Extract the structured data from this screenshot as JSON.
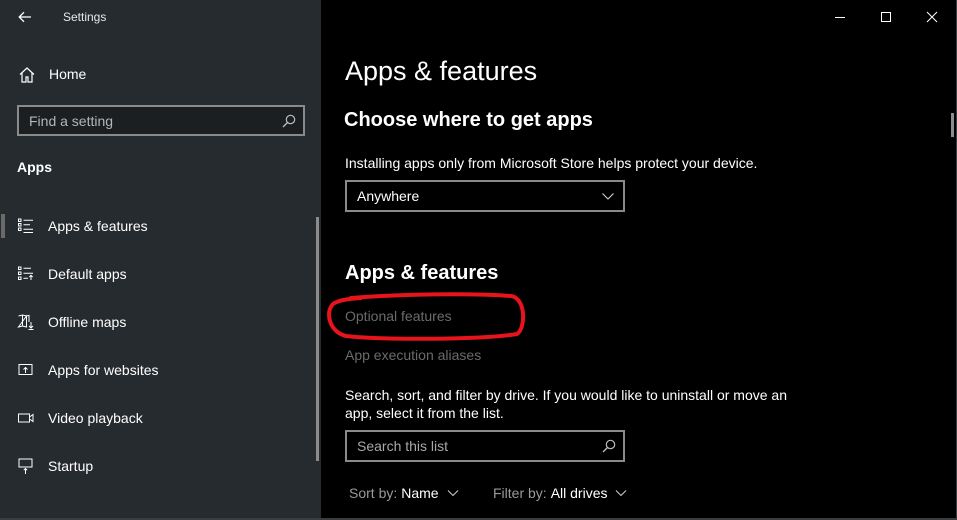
{
  "window": {
    "app_title": "Settings",
    "caption_buttons": [
      "minimize",
      "maximize",
      "close"
    ]
  },
  "sidebar": {
    "home_label": "Home",
    "search": {
      "placeholder": "Find a setting",
      "value": ""
    },
    "section_label": "Apps",
    "items": [
      {
        "label": "Apps & features",
        "icon": "apps-features-icon",
        "selected": true
      },
      {
        "label": "Default apps",
        "icon": "default-apps-icon",
        "selected": false
      },
      {
        "label": "Offline maps",
        "icon": "offline-maps-icon",
        "selected": false
      },
      {
        "label": "Apps for websites",
        "icon": "apps-for-websites-icon",
        "selected": false
      },
      {
        "label": "Video playback",
        "icon": "video-playback-icon",
        "selected": false
      },
      {
        "label": "Startup",
        "icon": "startup-icon",
        "selected": false
      }
    ]
  },
  "main": {
    "page_title": "Apps & features",
    "choose_heading": "Choose where to get apps",
    "choose_description": "Installing apps only from Microsoft Store helps protect your device.",
    "app_source_dropdown": {
      "selected": "Anywhere"
    },
    "section_heading": "Apps & features",
    "links": {
      "optional_features": "Optional features",
      "app_execution_aliases": "App execution aliases"
    },
    "list_description": "Search, sort, and filter by drive. If you would like to uninstall or move an app, select it from the list.",
    "list_search": {
      "placeholder": "Search this list",
      "value": ""
    },
    "sort": {
      "label": "Sort by:",
      "value": "Name"
    },
    "filter": {
      "label": "Filter by:",
      "value": "All drives"
    },
    "annotation_color": "#e8141c"
  },
  "colors": {
    "sidebar_bg": "#262b2f",
    "main_bg": "#000000",
    "disabled_link": "#6b6b6b",
    "border": "#8a8a8a"
  }
}
